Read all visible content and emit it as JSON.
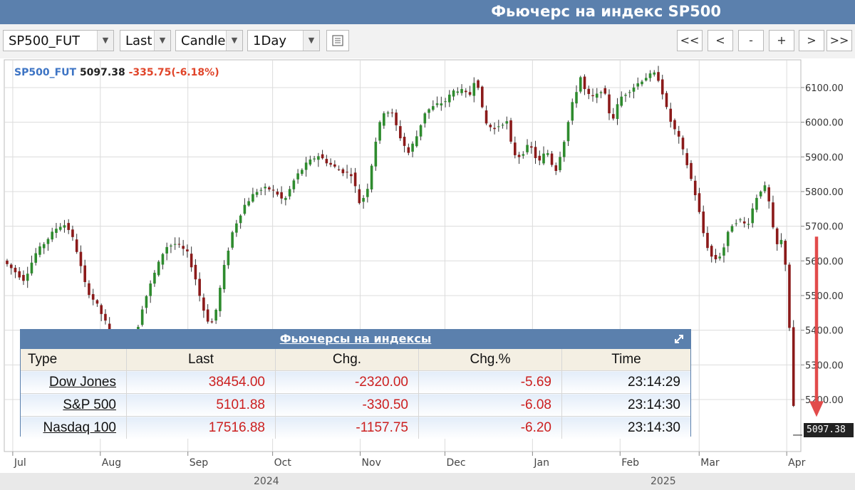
{
  "title": "Фьючерс на индекс SP500",
  "toolbar": {
    "symbol": "SP500_FUT",
    "price_type": "Last",
    "chart_type": "Candle",
    "interval": "1Day",
    "calendar_icon": "calendar-icon",
    "nav_buttons": [
      "<<",
      "<",
      "-",
      "+",
      ">",
      ">>"
    ]
  },
  "quote": {
    "symbol": "SP500_FUT",
    "price": "5097.38",
    "change": "-335.75(-6.18%)"
  },
  "last_price_tag": "5097.38",
  "table": {
    "title": "Фьючерсы на индексы",
    "columns": [
      "Type",
      "Last",
      "Chg.",
      "Chg.%",
      "Time"
    ],
    "rows": [
      {
        "name": "Dow Jones",
        "last": "38454.00",
        "chg": "-2320.00",
        "pct": "-5.69",
        "time": "23:14:29"
      },
      {
        "name": "S&P 500",
        "last": "5101.88",
        "chg": "-330.50",
        "pct": "-6.08",
        "time": "23:14:30"
      },
      {
        "name": "Nasdaq 100",
        "last": "17516.88",
        "chg": "-1157.75",
        "pct": "-6.20",
        "time": "23:14:30"
      }
    ]
  },
  "colors": {
    "up": "#2e8b2e",
    "down": "#8b1a1a",
    "header": "#5b80ad",
    "change_text": "#e0452a",
    "arrow": "#e24b4b"
  },
  "chart_data": {
    "type": "candlestick",
    "title": "",
    "interval": "1Day",
    "ylim": [
      5050,
      6180
    ],
    "yticks": [
      5200,
      5300,
      5400,
      5500,
      5600,
      5700,
      5800,
      5900,
      6000,
      6100
    ],
    "ytick_labels": [
      "5200.00",
      "5300.00",
      "5400.00",
      "5500.00",
      "5600.00",
      "5700.00",
      "5800.00",
      "5900.00",
      "6000.00",
      "6100.00"
    ],
    "months": [
      {
        "label": "Jul",
        "day": 0
      },
      {
        "label": "Aug",
        "day": 31
      },
      {
        "label": "Sep",
        "day": 62
      },
      {
        "label": "Oct",
        "day": 92
      },
      {
        "label": "Nov",
        "day": 123
      },
      {
        "label": "Dec",
        "day": 153
      },
      {
        "label": "Jan",
        "day": 184
      },
      {
        "label": "Feb",
        "day": 215
      },
      {
        "label": "Mar",
        "day": 243
      },
      {
        "label": "Apr",
        "day": 274
      }
    ],
    "years": [
      {
        "label": "2024",
        "day": 92
      },
      {
        "label": "2025",
        "day": 232
      }
    ],
    "day_range": [
      -3,
      279
    ],
    "last_price": 5097.38,
    "trend": [
      [
        -2,
        5590
      ],
      [
        4,
        5545
      ],
      [
        8,
        5620
      ],
      [
        12,
        5660
      ],
      [
        16,
        5700
      ],
      [
        19,
        5705
      ],
      [
        22,
        5650
      ],
      [
        26,
        5520
      ],
      [
        30,
        5470
      ],
      [
        33,
        5420
      ],
      [
        36,
        5300
      ],
      [
        38,
        5200
      ],
      [
        42,
        5330
      ],
      [
        46,
        5470
      ],
      [
        50,
        5560
      ],
      [
        54,
        5640
      ],
      [
        58,
        5650
      ],
      [
        62,
        5620
      ],
      [
        65,
        5540
      ],
      [
        67,
        5470
      ],
      [
        70,
        5410
      ],
      [
        72,
        5460
      ],
      [
        75,
        5590
      ],
      [
        78,
        5690
      ],
      [
        82,
        5760
      ],
      [
        86,
        5800
      ],
      [
        90,
        5810
      ],
      [
        93,
        5800
      ],
      [
        96,
        5770
      ],
      [
        100,
        5840
      ],
      [
        104,
        5880
      ],
      [
        108,
        5905
      ],
      [
        112,
        5880
      ],
      [
        116,
        5860
      ],
      [
        120,
        5850
      ],
      [
        123,
        5760
      ],
      [
        126,
        5820
      ],
      [
        128,
        5930
      ],
      [
        131,
        6030
      ],
      [
        134,
        6030
      ],
      [
        137,
        5960
      ],
      [
        140,
        5910
      ],
      [
        143,
        5960
      ],
      [
        146,
        6030
      ],
      [
        150,
        6050
      ],
      [
        153,
        6060
      ],
      [
        156,
        6090
      ],
      [
        159,
        6090
      ],
      [
        162,
        6080
      ],
      [
        164,
        6140
      ],
      [
        167,
        6000
      ],
      [
        170,
        5980
      ],
      [
        173,
        5995
      ],
      [
        175,
        6000
      ],
      [
        177,
        5910
      ],
      [
        180,
        5900
      ],
      [
        183,
        5940
      ],
      [
        186,
        5880
      ],
      [
        189,
        5920
      ],
      [
        192,
        5855
      ],
      [
        195,
        5940
      ],
      [
        198,
        6050
      ],
      [
        201,
        6130
      ],
      [
        203,
        6080
      ],
      [
        206,
        6070
      ],
      [
        209,
        6100
      ],
      [
        212,
        6000
      ],
      [
        215,
        6070
      ],
      [
        218,
        6090
      ],
      [
        221,
        6110
      ],
      [
        224,
        6130
      ],
      [
        227,
        6140
      ],
      [
        229,
        6120
      ],
      [
        231,
        6050
      ],
      [
        233,
        6000
      ],
      [
        236,
        5950
      ],
      [
        239,
        5870
      ],
      [
        242,
        5780
      ],
      [
        245,
        5660
      ],
      [
        248,
        5600
      ],
      [
        251,
        5620
      ],
      [
        254,
        5700
      ],
      [
        257,
        5720
      ],
      [
        260,
        5700
      ],
      [
        263,
        5780
      ],
      [
        266,
        5820
      ],
      [
        268,
        5760
      ],
      [
        270,
        5640
      ],
      [
        272,
        5660
      ],
      [
        274,
        5570
      ],
      [
        275,
        5400
      ],
      [
        276,
        5230
      ],
      [
        277,
        5097
      ]
    ]
  }
}
